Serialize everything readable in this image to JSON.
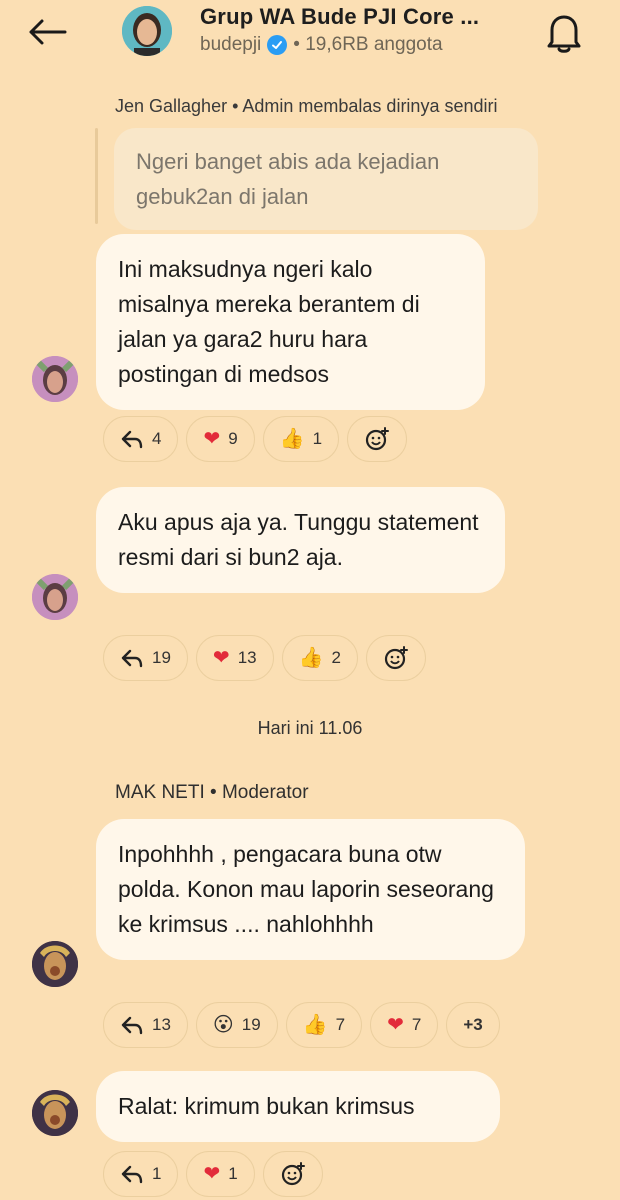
{
  "header": {
    "title": "Grup WA Bude PJI Core ...",
    "handle": "budepji",
    "members": "• 19,6RB anggota"
  },
  "reply_context": {
    "header": "Jen Gallagher • Admin membalas dirinya sendiri",
    "quote": "Ngeri banget abis ada kejadian gebuk2an di jalan"
  },
  "messages": [
    {
      "text": "Ini maksudnya ngeri kalo misalnya mereka berantem di jalan ya gara2 huru hara postingan di medsos",
      "reactions": {
        "reply": "4",
        "heart": "9",
        "thumbs": "1"
      }
    },
    {
      "text": "Aku apus aja ya. Tunggu statement resmi dari si bun2 aja.",
      "reactions": {
        "reply": "19",
        "heart": "13",
        "thumbs": "2"
      }
    },
    {
      "text": "Inpohhhh , pengacara buna otw polda. Konon mau laporin seseorang ke krimsus .... nahlohhhh",
      "reactions": {
        "reply": "13",
        "wow": "19",
        "thumbs": "7",
        "heart": "7",
        "more": "+3"
      }
    },
    {
      "text": "Ralat: krimum bukan krimsus",
      "reactions": {
        "reply": "1",
        "heart": "1"
      }
    }
  ],
  "date_separator": "Hari ini 11.06",
  "moderator_header": "MAK NETI • Moderator",
  "icons": {
    "back": "arrow-left-icon",
    "bell": "bell-icon",
    "reply": "reply-arrow-icon",
    "heart": "heart-emoji",
    "thumbs": "thumbs-up-emoji",
    "wow": "surprised-emoji",
    "add_reaction": "add-emoji-icon",
    "verified": "verified-badge-icon"
  },
  "colors": {
    "background": "#fbdfb4",
    "bubble": "#fff7ea",
    "quote_bubble": "#f9e7c9",
    "verified": "#2a9df4"
  }
}
